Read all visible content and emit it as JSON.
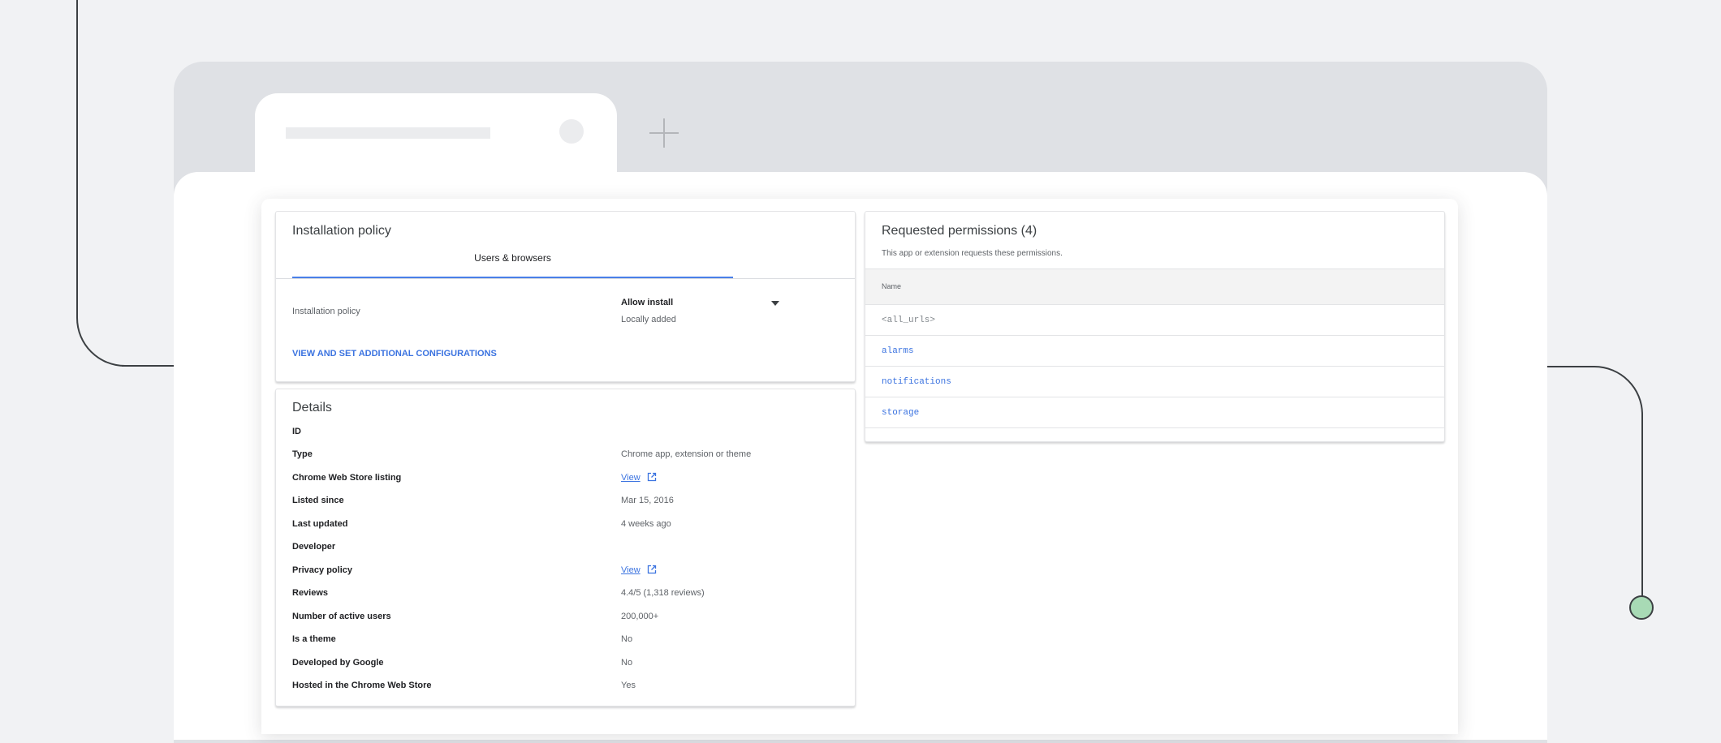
{
  "colors": {
    "accent": "#4a80e8",
    "link": "#3b73e0",
    "decor_line": "#3c4043",
    "decor_dot": "#a8dab5"
  },
  "icons": {
    "new_tab": "plus-icon",
    "dropdown": "caret-down-icon",
    "external_link": "open-in-new-icon"
  },
  "installation": {
    "title": "Installation policy",
    "tab_label": "Users & browsers",
    "policy_label": "Installation policy",
    "policy_value": "Allow install",
    "policy_sub": "Locally added",
    "config_link": "VIEW AND SET ADDITIONAL CONFIGURATIONS"
  },
  "details": {
    "title": "Details",
    "rows": [
      {
        "label": "ID",
        "value": ""
      },
      {
        "label": "Type",
        "value": "Chrome app, extension or theme"
      },
      {
        "label": "Chrome Web Store listing",
        "value": "View",
        "link": true
      },
      {
        "label": "Listed since",
        "value": "Mar 15, 2016"
      },
      {
        "label": "Last updated",
        "value": "4 weeks ago"
      },
      {
        "label": "Developer",
        "value": ""
      },
      {
        "label": "Privacy policy",
        "value": "View",
        "link": true
      },
      {
        "label": "Reviews",
        "value": "4.4/5 (1,318 reviews)"
      },
      {
        "label": "Number of active users",
        "value": "200,000+"
      },
      {
        "label": "Is a theme",
        "value": "No"
      },
      {
        "label": "Developed by Google",
        "value": "No"
      },
      {
        "label": "Hosted in the Chrome Web Store",
        "value": "Yes"
      }
    ]
  },
  "permissions": {
    "title": "Requested permissions (4)",
    "subtitle": "This app or extension requests these permissions.",
    "column_name": "Name",
    "items": [
      {
        "name": "<all_urls>",
        "color": "#80868b"
      },
      {
        "name": "alarms",
        "color": "#3b73e0"
      },
      {
        "name": "notifications",
        "color": "#3b73e0"
      },
      {
        "name": "storage",
        "color": "#3b73e0"
      }
    ]
  }
}
